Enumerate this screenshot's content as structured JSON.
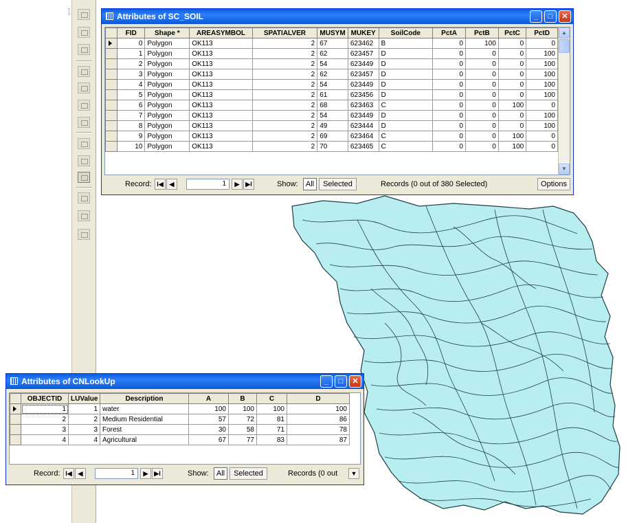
{
  "soil_window": {
    "title": "Attributes of SC_SOIL",
    "columns": [
      "FID",
      "Shape *",
      "AREASYMBOL",
      "SPATIALVER",
      "MUSYM",
      "MUKEY",
      "SoilCode",
      "PctA",
      "PctB",
      "PctC",
      "PctD"
    ],
    "rows": [
      [
        "0",
        "Polygon",
        "OK113",
        "2",
        "67",
        "623462",
        "B",
        "0",
        "100",
        "0",
        "0"
      ],
      [
        "1",
        "Polygon",
        "OK113",
        "2",
        "62",
        "623457",
        "D",
        "0",
        "0",
        "0",
        "100"
      ],
      [
        "2",
        "Polygon",
        "OK113",
        "2",
        "54",
        "623449",
        "D",
        "0",
        "0",
        "0",
        "100"
      ],
      [
        "3",
        "Polygon",
        "OK113",
        "2",
        "62",
        "623457",
        "D",
        "0",
        "0",
        "0",
        "100"
      ],
      [
        "4",
        "Polygon",
        "OK113",
        "2",
        "54",
        "623449",
        "D",
        "0",
        "0",
        "0",
        "100"
      ],
      [
        "5",
        "Polygon",
        "OK113",
        "2",
        "61",
        "623456",
        "D",
        "0",
        "0",
        "0",
        "100"
      ],
      [
        "6",
        "Polygon",
        "OK113",
        "2",
        "68",
        "623463",
        "C",
        "0",
        "0",
        "100",
        "0"
      ],
      [
        "7",
        "Polygon",
        "OK113",
        "2",
        "54",
        "623449",
        "D",
        "0",
        "0",
        "0",
        "100"
      ],
      [
        "8",
        "Polygon",
        "OK113",
        "2",
        "49",
        "623444",
        "D",
        "0",
        "0",
        "0",
        "100"
      ],
      [
        "9",
        "Polygon",
        "OK113",
        "2",
        "69",
        "623464",
        "C",
        "0",
        "0",
        "100",
        "0"
      ],
      [
        "10",
        "Polygon",
        "OK113",
        "2",
        "70",
        "623465",
        "C",
        "0",
        "0",
        "100",
        "0"
      ]
    ],
    "record_label": "Record:",
    "record_value": "1",
    "show_label": "Show:",
    "all_label": "All",
    "selected_label": "Selected",
    "records_status": "Records (0 out of 380 Selected)",
    "options_label": "Options"
  },
  "cn_window": {
    "title": "Attributes of CNLookUp",
    "columns": [
      "OBJECTID",
      "LUValue",
      "Description",
      "A",
      "B",
      "C",
      "D"
    ],
    "rows": [
      [
        "1",
        "1",
        "water",
        "100",
        "100",
        "100",
        "100"
      ],
      [
        "2",
        "2",
        "Medium Residential",
        "57",
        "72",
        "81",
        "86"
      ],
      [
        "3",
        "3",
        "Forest",
        "30",
        "58",
        "71",
        "78"
      ],
      [
        "4",
        "4",
        "Agricultural",
        "67",
        "77",
        "83",
        "87"
      ]
    ],
    "record_label": "Record:",
    "record_value": "1",
    "show_label": "Show:",
    "all_label": "All",
    "selected_label": "Selected",
    "records_status": "Records (0 out"
  },
  "window_glyphs": {
    "minimize": "_",
    "maximize": "□",
    "close": "✕"
  },
  "nav_glyphs": {
    "first": "I◀",
    "prev": "◀",
    "next": "▶",
    "last": "▶I",
    "scroll_up": "▲",
    "scroll_down": "▼",
    "dropdown": "▼"
  },
  "colors": {
    "map_fill": "#b9eef1",
    "map_outline": "#1d3e46",
    "title_blue": "#0a5ee6",
    "window_bg": "#ece9d8"
  }
}
